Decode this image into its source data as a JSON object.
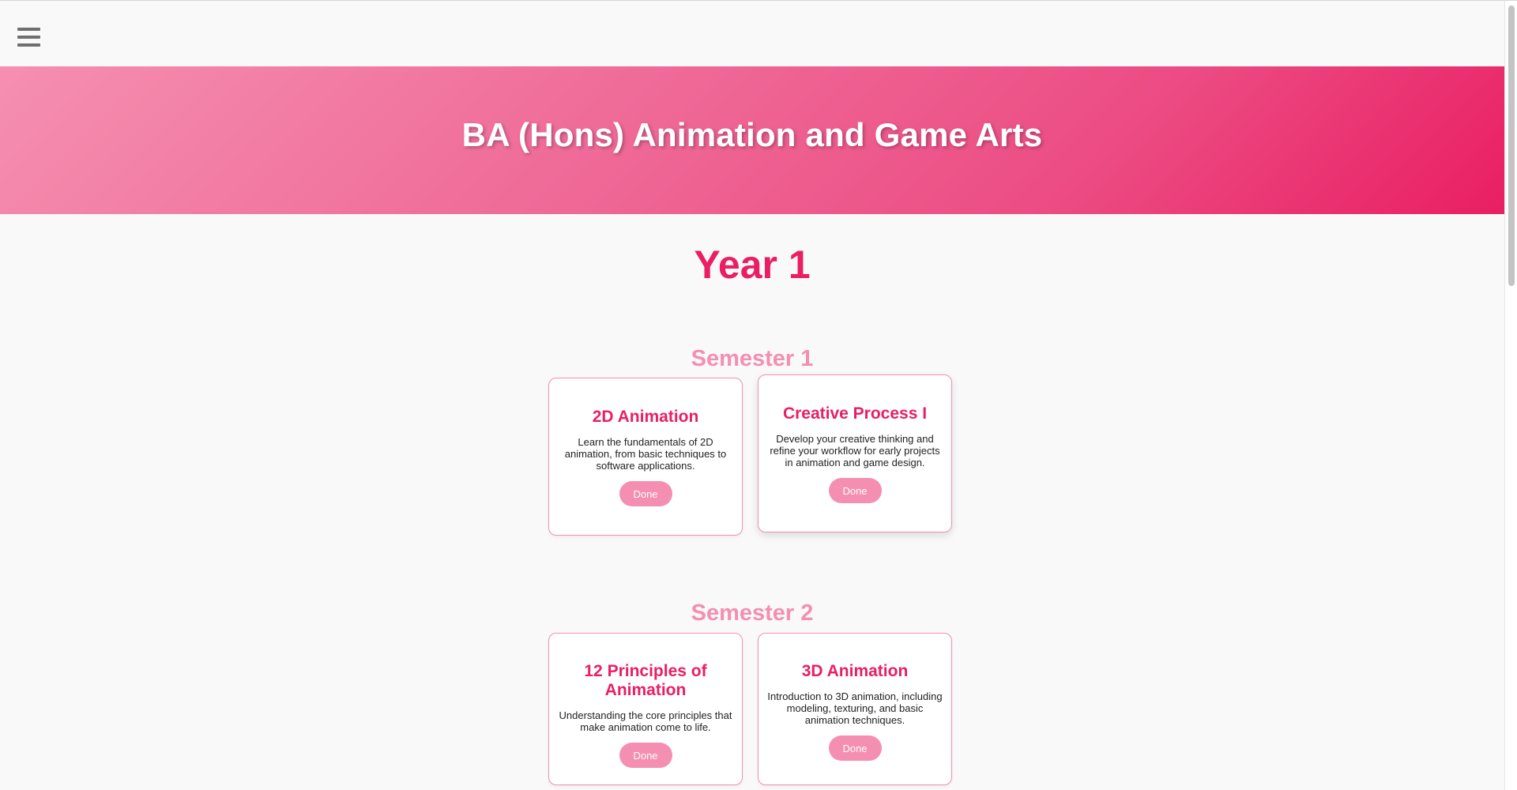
{
  "hero": {
    "title": "BA (Hons) Animation and Game Arts"
  },
  "year": {
    "title": "Year 1"
  },
  "semesters": [
    {
      "title": "Semester 1",
      "modules": [
        {
          "title": "2D Animation",
          "description": "Learn the fundamentals of 2D animation, from basic techniques to software applications.",
          "button_label": "Done"
        },
        {
          "title": "Creative Process I",
          "description": "Develop your creative thinking and refine your workflow for early projects in animation and game design.",
          "button_label": "Done"
        }
      ]
    },
    {
      "title": "Semester 2",
      "modules": [
        {
          "title": "12 Principles of Animation",
          "description": "Understanding the core principles that make animation come to life.",
          "button_label": "Done"
        },
        {
          "title": "3D Animation",
          "description": "Introduction to 3D animation, including modeling, texturing, and basic animation techniques.",
          "button_label": "Done"
        }
      ]
    }
  ],
  "icons": {
    "menu": "hamburger-menu-icon"
  },
  "colors": {
    "accent": "#e91e63",
    "secondary": "#f48fb1",
    "background": "#f9f9f9"
  }
}
